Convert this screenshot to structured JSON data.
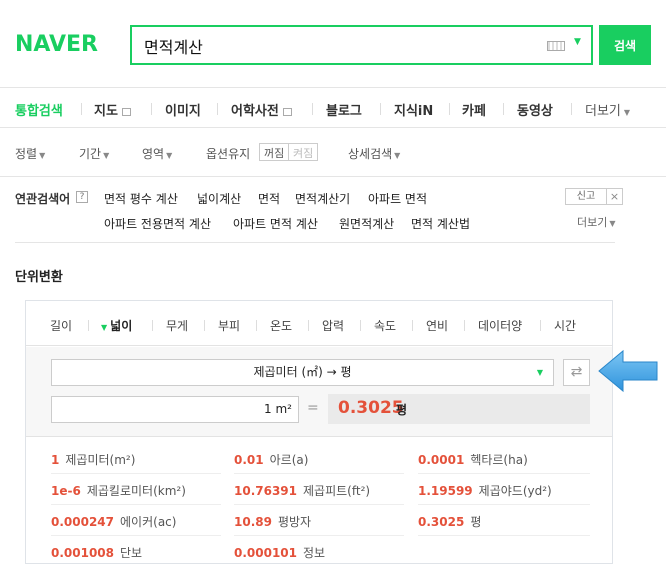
{
  "header": {
    "logo": "NAVER",
    "search_value": "면적계산",
    "search_button": "검색"
  },
  "nav": {
    "items": [
      "통합검색",
      "지도",
      "이미지",
      "어학사전",
      "블로그",
      "지식iN",
      "카페",
      "동영상",
      "더보기"
    ]
  },
  "options": {
    "sort": "정렬",
    "period": "기간",
    "area": "영역",
    "keep_option": "옵션유지",
    "off_label": "꺼짐",
    "on_label": "켜짐",
    "detail": "상세검색"
  },
  "related": {
    "title": "연관검색어",
    "help": "?",
    "links_row1": [
      "면적 평수 계산",
      "넓이계산",
      "면적",
      "면적계산기",
      "아파트 면적"
    ],
    "links_row2": [
      "아파트 전용면적 계산",
      "아파트 면적 계산",
      "원면적계산",
      "면적 계산법"
    ],
    "report": "신고",
    "close": "×",
    "more": "더보기"
  },
  "converter": {
    "title": "단위변환",
    "categories": [
      "길이",
      "넓이",
      "무게",
      "부피",
      "온도",
      "압력",
      "속도",
      "연비",
      "데이터양",
      "시간"
    ],
    "active_category": "넓이",
    "unit_select": "제곱미터 (㎡) → 평",
    "swap_icon": "⇄",
    "input_value": "1 m²",
    "equals": "=",
    "result_value": "0.3025",
    "result_unit": "평",
    "results": [
      {
        "num": "1",
        "unit": "제곱미터(m²)"
      },
      {
        "num": "0.01",
        "unit": "아르(a)"
      },
      {
        "num": "0.0001",
        "unit": "헥타르(ha)"
      },
      {
        "num": "1e-6",
        "unit": "제곱킬로미터(km²)"
      },
      {
        "num": "10.76391",
        "unit": "제곱피트(ft²)"
      },
      {
        "num": "1.19599",
        "unit": "제곱야드(yd²)"
      },
      {
        "num": "0.000247",
        "unit": "에이커(ac)"
      },
      {
        "num": "10.89",
        "unit": "평방자"
      },
      {
        "num": "0.3025",
        "unit": "평"
      },
      {
        "num": "0.001008",
        "unit": "단보"
      },
      {
        "num": "0.000101",
        "unit": "정보"
      }
    ]
  },
  "colors": {
    "brand": "#19ce60",
    "result": "#e4513a",
    "callout": "#4aa8e8"
  }
}
